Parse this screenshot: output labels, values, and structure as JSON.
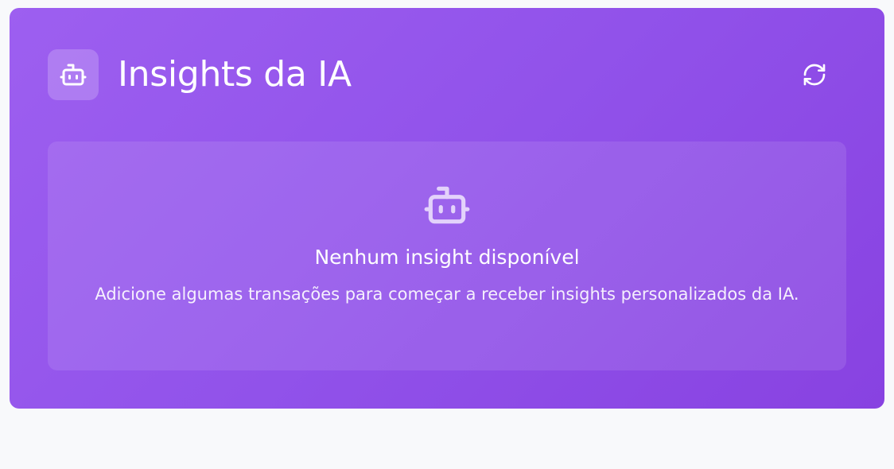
{
  "header": {
    "title": "Insights da IA",
    "icon": "robot-icon",
    "refresh_icon": "refresh-icon"
  },
  "empty_state": {
    "icon": "robot-icon",
    "title": "Nenhum insight disponível",
    "text": "Adicione algumas transações para começar a receber insights personalizados da IA."
  },
  "colors": {
    "card_gradient_start": "#9d5ff0",
    "card_gradient_end": "#8842e1",
    "page_background": "#f8f9fb",
    "text": "#ffffff"
  }
}
